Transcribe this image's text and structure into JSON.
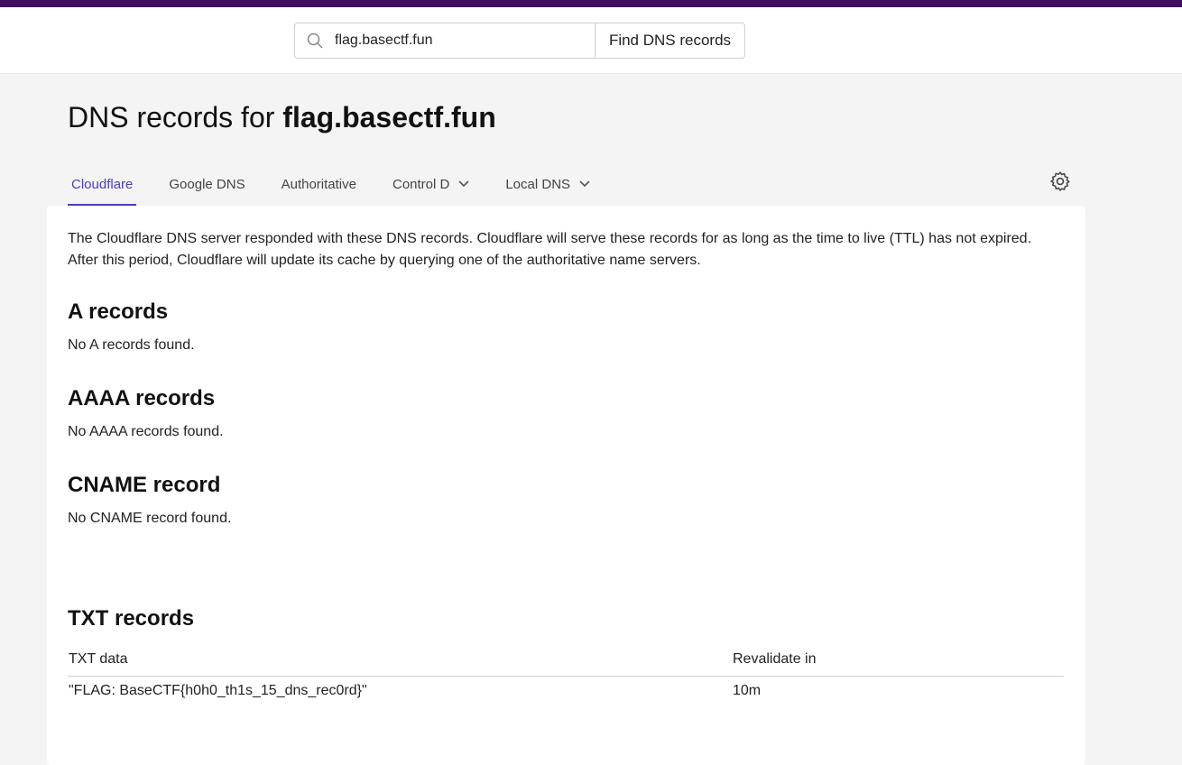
{
  "search": {
    "value": "flag.basectf.fun",
    "button_label": "Find DNS records"
  },
  "page": {
    "title_prefix": "DNS records for ",
    "domain": "flag.basectf.fun"
  },
  "tabs": [
    {
      "label": "Cloudflare",
      "active": true
    },
    {
      "label": "Google DNS"
    },
    {
      "label": "Authoritative"
    },
    {
      "label": "Control D",
      "dropdown": true
    },
    {
      "label": "Local DNS",
      "dropdown": true
    }
  ],
  "intro": "The Cloudflare DNS server responded with these DNS records. Cloudflare will serve these records for as long as the time to live (TTL) has not expired. After this period, Cloudflare will update its cache by querying one of the authoritative name servers.",
  "sections": {
    "a": {
      "title": "A records",
      "empty": "No A records found."
    },
    "aaaa": {
      "title": "AAAA records",
      "empty": "No AAAA records found."
    },
    "cname": {
      "title": "CNAME record",
      "empty": "No CNAME record found."
    },
    "txt": {
      "title": "TXT records",
      "columns": [
        "TXT data",
        "Revalidate in"
      ],
      "rows": [
        {
          "data": "\"FLAG: BaseCTF{h0h0_th1s_15_dns_rec0rd}\"",
          "revalidate": "10m"
        }
      ]
    }
  },
  "colors": {
    "accent": "#4a3fb5",
    "top_strip": "#3e0f5e",
    "background": "#f4f4f4"
  },
  "icons": {
    "search": "search-icon",
    "settings": "gear-icon",
    "dropdown": "chevron-down-icon"
  }
}
